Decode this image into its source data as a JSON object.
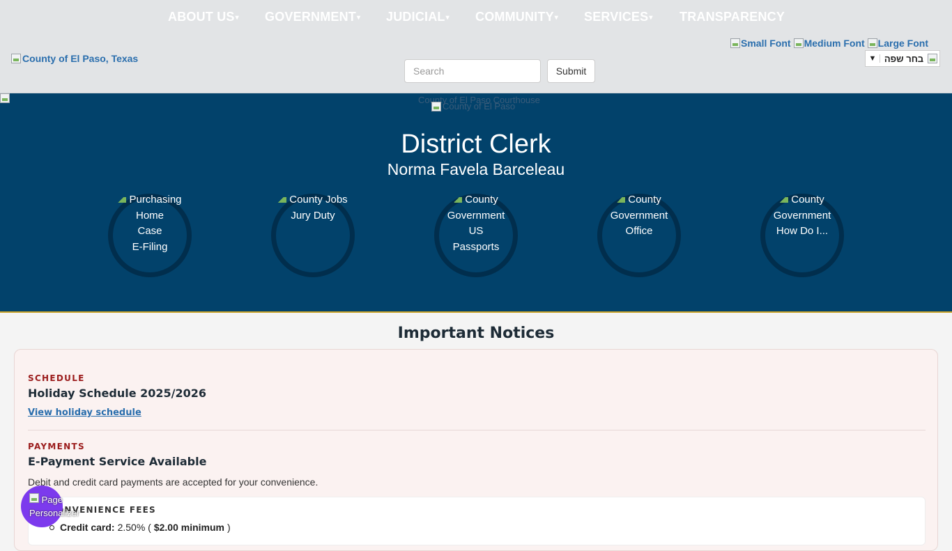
{
  "nav": {
    "items": [
      {
        "label": "ABOUT US",
        "caret": true
      },
      {
        "label": "GOVERNMENT",
        "caret": true
      },
      {
        "label": "JUDICIAL",
        "caret": true
      },
      {
        "label": "COMMUNITY",
        "caret": true
      },
      {
        "label": "SERVICES",
        "caret": true
      },
      {
        "label": "TRANSPARENCY",
        "caret": false
      }
    ]
  },
  "header": {
    "logo_alt": "County of El Paso, Texas",
    "search_placeholder": "Search",
    "submit_label": "Submit",
    "font_small": "Small Font",
    "font_medium": "Medium Font",
    "font_large": "Large Font",
    "language_label": "בחר שפה"
  },
  "hero": {
    "alt_text_1": "County of El Paso Courthouse",
    "alt_text_2": "County of El Paso",
    "title": "District Clerk",
    "subtitle": "Norma Favela Barceleau",
    "quicklinks": [
      {
        "lines": [
          "Purchasing",
          "Home",
          "Case",
          "E-Filing"
        ]
      },
      {
        "lines": [
          "County Jobs",
          "Jury Duty"
        ]
      },
      {
        "lines": [
          "County",
          "Government",
          "US",
          "Passports"
        ]
      },
      {
        "lines": [
          "County",
          "Government",
          "Office"
        ]
      },
      {
        "lines": [
          "County",
          "Government",
          "How Do I..."
        ]
      }
    ]
  },
  "notices": {
    "heading": "Important Notices",
    "schedule_kicker": "SCHEDULE",
    "schedule_title": "Holiday Schedule 2025/2026",
    "schedule_link": "View holiday schedule",
    "payments_kicker": "PAYMENTS",
    "payments_title": "E-Payment Service Available",
    "payments_desc": "Debit and credit card payments are accepted for your convenience.",
    "fees_title": "CONVENIENCE FEES",
    "fee_label": "Credit card:",
    "fee_rate": "2.50% (",
    "fee_min": "$2.00 minimum",
    "fee_close": ")"
  },
  "fab": {
    "label": "Page Personalizer"
  },
  "colors": {
    "hero_bg": "#02426b",
    "accent_gold": "#c9a227",
    "link": "#2a6ead",
    "kicker": "#9b1c1c",
    "fab": "#7c3aed"
  }
}
